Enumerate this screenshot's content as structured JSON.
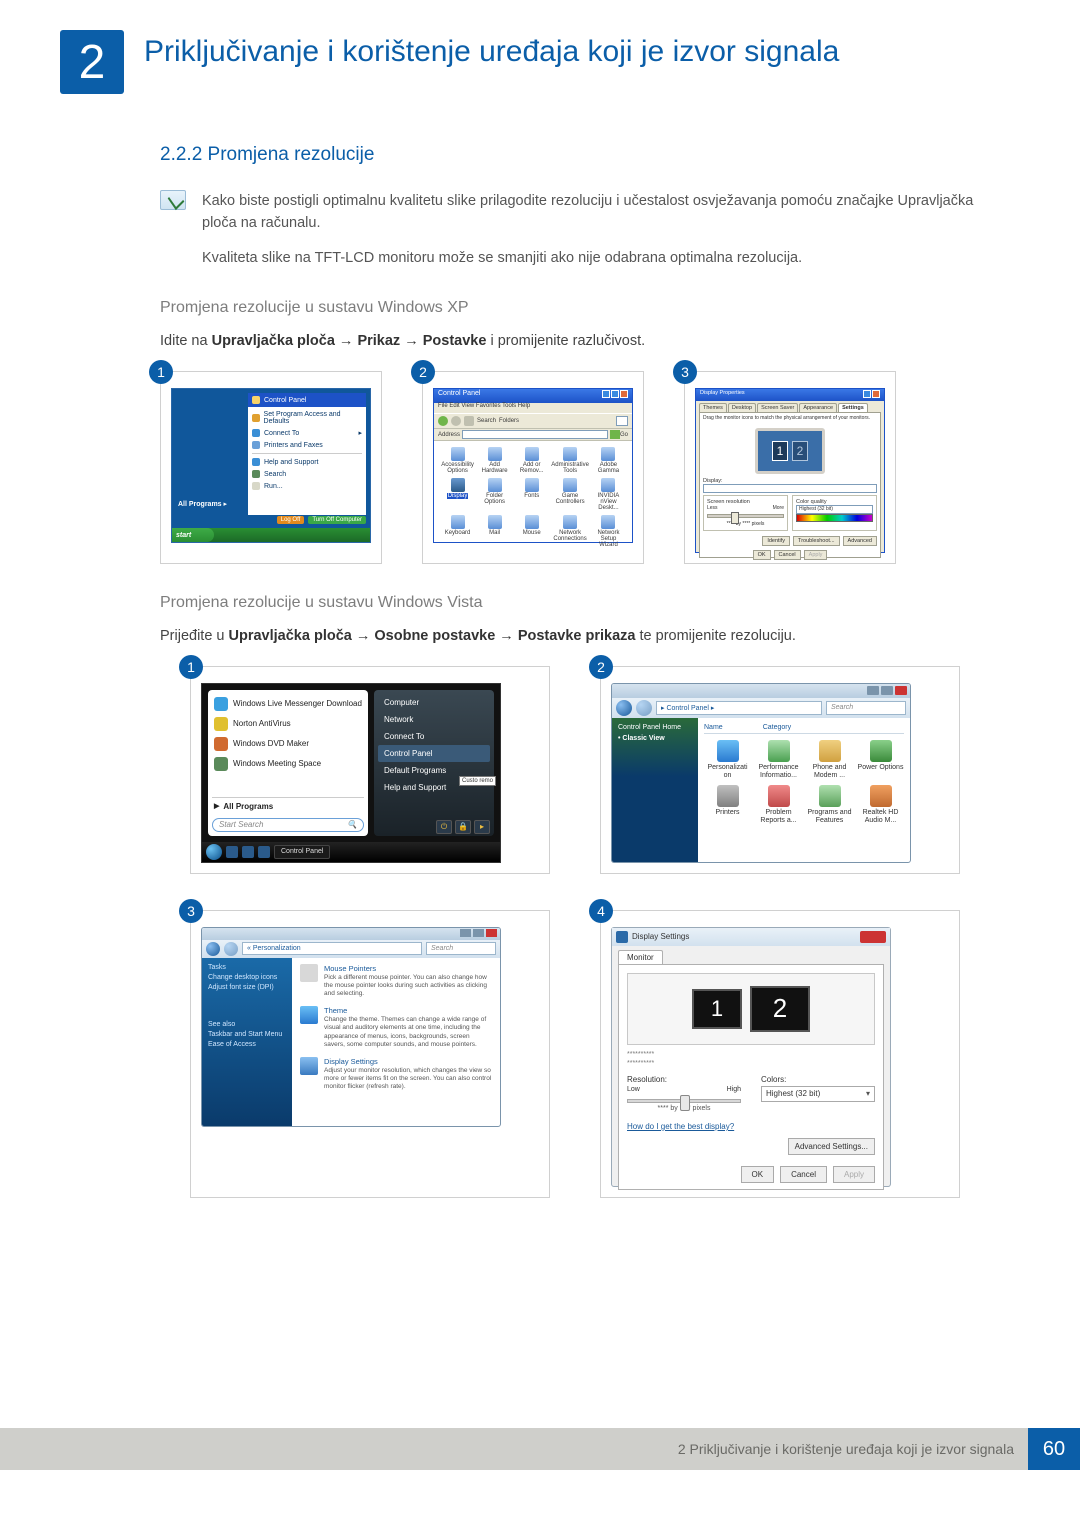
{
  "chapter": {
    "number": "2",
    "title": "Priključivanje i korištenje uređaja koji je izvor signala"
  },
  "section": {
    "number_title": "2.2.2 Promjena rezolucije"
  },
  "note": {
    "p1": "Kako biste postigli optimalnu kvalitetu slike prilagodite rezoluciju i učestalost osvježavanja pomoću značajke Upravljačka ploča na računalu.",
    "p2": "Kvaliteta slike na TFT-LCD monitoru može se smanjiti ako nije odabrana optimalna rezolucija."
  },
  "xp": {
    "heading": "Promjena rezolucije u sustavu Windows XP",
    "instruction_pre": "Idite na ",
    "instruction_bold": "Upravljačka ploča → Prikaz → Postavke",
    "instruction_post": " i promijenite razlučivost.",
    "badge1": "1",
    "badge2": "2",
    "badge3": "3",
    "start": {
      "title": "Control Panel",
      "items": [
        "Set Program Access and Defaults",
        "Connect To",
        "Printers and Faxes",
        "Help and Support",
        "Search",
        "Run..."
      ],
      "all_programs": "All Programs",
      "logoff": "Log Off",
      "shutdown": "Turn Off Computer",
      "start_btn": "start"
    },
    "cp": {
      "title": "Control Panel",
      "menu": "File   Edit   View   Favorites   Tools   Help",
      "search": "Search",
      "folders": "Folders",
      "address": "Address",
      "go": "Go",
      "icons": [
        "Accessibility Options",
        "Add Hardware",
        "Add or Remov...",
        "Administrative Tools",
        "Adobe Gamma",
        "Display",
        "Folder Options",
        "Fonts",
        "Game Controllers",
        "INVIDIA nView Deskt...",
        "Keyboard",
        "Mail",
        "Mouse",
        "Network Connections",
        "Network Setup Wizard"
      ]
    },
    "dp": {
      "title": "Display Properties",
      "tabs": [
        "Themes",
        "Desktop",
        "Screen Saver",
        "Appearance",
        "Settings"
      ],
      "drag": "Drag the monitor icons to match the physical arrangement of your monitors.",
      "m1": "1",
      "m2": "2",
      "display": "Display:",
      "sr": "Screen resolution",
      "less": "Less",
      "more": "More",
      "px": "**** by **** pixels",
      "cq": "Color quality",
      "cqv": "Highest (32 bit)",
      "btns": [
        "Identify",
        "Troubleshoot...",
        "Advanced"
      ],
      "ok": "OK",
      "cancel": "Cancel",
      "apply": "Apply"
    }
  },
  "vista": {
    "heading": "Promjena rezolucije u sustavu Windows Vista",
    "instruction_pre": "Prijeđite u  ",
    "instruction_bold": "Upravljačka ploča → Osobne postavke → Postavke prikaza",
    "instruction_post": " te promijenite rezoluciju.",
    "badge1": "1",
    "badge2": "2",
    "badge3": "3",
    "badge4": "4",
    "start": {
      "left": [
        "Windows Live Messenger Download",
        "Norton AntiVirus",
        "Windows DVD Maker",
        "Windows Meeting Space"
      ],
      "all_programs": "All Programs",
      "search_ph": "Start Search",
      "right": [
        "Computer",
        "Network",
        "Connect To",
        "Control Panel",
        "Default Programs",
        "Help and Support"
      ],
      "custo": "Custo remo",
      "task": "Control Panel"
    },
    "cp": {
      "crumb": "▸ Control Panel ▸",
      "search": "Search",
      "side_home": "Control Panel Home",
      "side_classic": "Classic View",
      "hdr_name": "Name",
      "hdr_cat": "Category",
      "icons": [
        "Personalizati on",
        "Performance Informatio...",
        "Phone and Modem ...",
        "Power Options",
        "Printers",
        "Problem Reports a...",
        "Programs and Features",
        "Realtek HD Audio M..."
      ]
    },
    "pers": {
      "crumb": "« Personalization",
      "search": "Search",
      "tasks": "Tasks",
      "side": [
        "Change desktop icons",
        "Adjust font size (DPI)"
      ],
      "seealso": "See also",
      "side2": [
        "Taskbar and Start Menu",
        "Ease of Access"
      ],
      "e1_t": "Mouse Pointers",
      "e1_d": "Pick a different mouse pointer. You can also change how the mouse pointer looks during such activities as clicking and selecting.",
      "e2_t": "Theme",
      "e2_d": "Change the theme. Themes can change a wide range of visual and auditory elements at one time, including the appearance of menus, icons, backgrounds, screen savers, some computer sounds, and mouse pointers.",
      "e3_t": "Display Settings",
      "e3_d": "Adjust your monitor resolution, which changes the view so more or fewer items fit on the screen. You can also control monitor flicker (refresh rate)."
    },
    "ds": {
      "title": "Display Settings",
      "tab": "Monitor",
      "m1": "1",
      "m2": "2",
      "chk1": "**********",
      "chk2": "**********",
      "res": "Resolution:",
      "low": "Low",
      "high": "High",
      "px": "**** by **** pixels",
      "col": "Colors:",
      "colv": "Highest (32 bit)",
      "link": "How do I get the best display?",
      "adv": "Advanced Settings...",
      "ok": "OK",
      "cancel": "Cancel",
      "apply": "Apply"
    }
  },
  "footer": {
    "text": "2 Priključivanje i korištenje uređaja koji je izvor signala",
    "page": "60"
  }
}
